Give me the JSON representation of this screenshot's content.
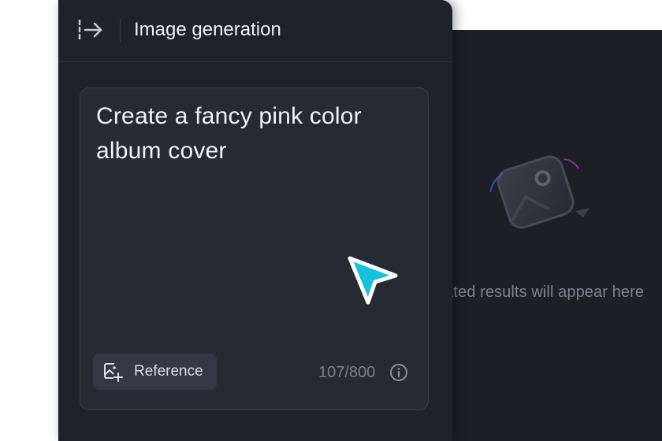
{
  "header": {
    "title": "Image generation",
    "toggle_icon": "sidebar-collapse-arrow-icon"
  },
  "prompt": {
    "text": "Create a fancy pink color album cover",
    "char_count": "107/800"
  },
  "reference_button": {
    "label": "Reference",
    "icon": "add-image-icon"
  },
  "results": {
    "placeholder_text": "Generated results will appear here"
  },
  "colors": {
    "sidebar_bg": "#1f2229",
    "card_bg": "#262a33",
    "results_bg": "#1c1f26",
    "cursor": "#17c1e0"
  }
}
